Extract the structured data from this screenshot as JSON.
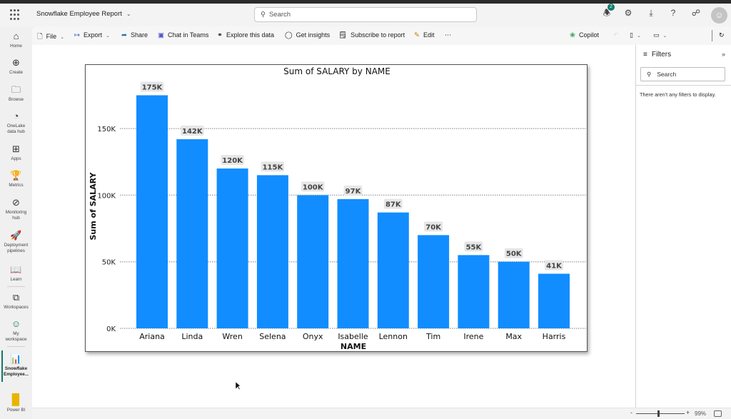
{
  "header": {
    "app_title": "Snowflake Employee Report",
    "search_placeholder": "Search",
    "notification_count": "2",
    "icons": [
      "bell-icon",
      "gear-icon",
      "download-icon",
      "help-icon",
      "share-people-icon",
      "avatar-icon"
    ]
  },
  "leftnav": {
    "items": [
      {
        "label": "Home",
        "icon": "home-icon"
      },
      {
        "label": "Create",
        "icon": "plus-circle-icon"
      },
      {
        "label": "Browse",
        "icon": "folder-icon"
      },
      {
        "label": "OneLake data hub",
        "icon": "onelake-icon"
      },
      {
        "label": "Apps",
        "icon": "apps-icon"
      },
      {
        "label": "Metrics",
        "icon": "trophy-icon"
      },
      {
        "label": "Monitoring hub",
        "icon": "monitor-icon"
      },
      {
        "label": "Deployment pipelines",
        "icon": "rocket-icon"
      },
      {
        "label": "Learn",
        "icon": "book-icon"
      },
      {
        "label": "Workspaces",
        "icon": "workspaces-icon"
      },
      {
        "label": "My workspace",
        "icon": "person-icon"
      },
      {
        "label": "Snowflake Employee...",
        "icon": "report-icon"
      },
      {
        "label": "Power BI",
        "icon": "powerbi-logo-icon"
      }
    ]
  },
  "toolbar": {
    "file": "File",
    "export": "Export",
    "share": "Share",
    "chat_in_teams": "Chat in Teams",
    "explore": "Explore this data",
    "insights": "Get insights",
    "subscribe": "Subscribe to report",
    "edit": "Edit",
    "more": "⋯",
    "copilot": "Copilot"
  },
  "filters": {
    "title": "Filters",
    "search_placeholder": "Search",
    "empty_message": "There aren't any filters to display."
  },
  "statusbar": {
    "zoom_level": "99%",
    "zoom_minus": "-",
    "zoom_plus": "+"
  },
  "colors": {
    "bar": "#118DFF",
    "accent": "#117865",
    "label_bg": "#E6E6E6"
  },
  "chart_data": {
    "type": "bar",
    "title": "Sum of SALARY by NAME",
    "xlabel": "NAME",
    "ylabel": "Sum of SALARY",
    "categories": [
      "Ariana",
      "Linda",
      "Wren",
      "Selena",
      "Onyx",
      "Isabelle",
      "Lennon",
      "Tim",
      "Irene",
      "Max",
      "Harris"
    ],
    "values": [
      175000,
      142000,
      120000,
      115000,
      100000,
      97000,
      87000,
      70000,
      55000,
      50000,
      41000
    ],
    "data_labels": [
      "175K",
      "142K",
      "120K",
      "115K",
      "100K",
      "97K",
      "87K",
      "70K",
      "55K",
      "50K",
      "41K"
    ],
    "yticks": [
      0,
      50000,
      100000,
      150000
    ],
    "ytick_labels": [
      "0K",
      "50K",
      "100K",
      "150K"
    ],
    "ylim": [
      0,
      175000
    ],
    "grid": true,
    "legend": "none"
  }
}
